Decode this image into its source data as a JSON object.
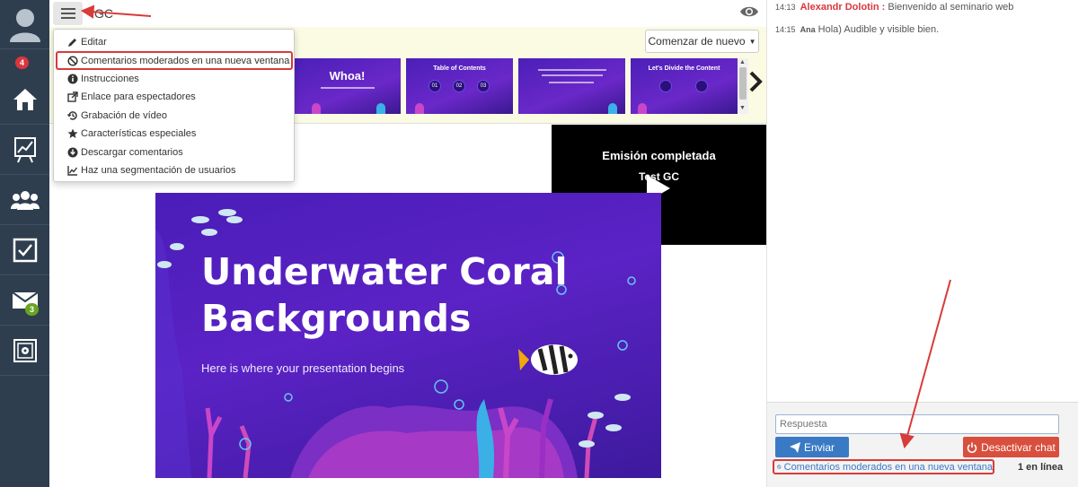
{
  "sidebar": {
    "badges": {
      "profile": "4",
      "mail": "3"
    }
  },
  "topbar": {
    "title": "GC"
  },
  "strip": {
    "start_button": "Comenzar de nuevo",
    "thumbs": [
      {
        "title": "Whoa!"
      },
      {
        "title": "Table of Contents",
        "nums": [
          "01",
          "02",
          "03"
        ]
      },
      {
        "title": ""
      },
      {
        "title": "Let's Divide the Content"
      }
    ]
  },
  "menu": {
    "items": [
      {
        "label": "Editar",
        "icon": "pencil-icon"
      },
      {
        "label": "Comentarios moderados en una nueva ventana",
        "icon": "ban-icon"
      },
      {
        "label": "Instrucciones",
        "icon": "info-icon"
      },
      {
        "label": "Enlace para espectadores",
        "icon": "external-link-icon"
      },
      {
        "label": "Grabación de vídeo",
        "icon": "history-icon"
      },
      {
        "label": "Características especiales",
        "icon": "star-icon"
      },
      {
        "label": "Descargar comentarios",
        "icon": "download-icon"
      },
      {
        "label": "Haz una segmentación de usuarios",
        "icon": "chart-icon"
      }
    ]
  },
  "video": {
    "title": "Emisión completada",
    "subtitle": "Test GC"
  },
  "slide": {
    "title_line1": "Underwater Coral",
    "title_line2": "Backgrounds",
    "subtitle": "Here is where your presentation begins"
  },
  "chat": {
    "messages": [
      {
        "time": "14:13",
        "user": "Alexandr Dolotin :",
        "text": " Bienvenido al seminario web"
      },
      {
        "time": "14:15",
        "user": "Ana",
        "text": " Hola) Audible y visible bien."
      }
    ],
    "reply_placeholder": "Respuesta",
    "send_label": "Enviar",
    "disable_label": "Desactivar chat",
    "moderated_link": "Comentarios moderados en una nueva ventana",
    "online": "1 en línea"
  },
  "colors": {
    "sidebar": "#2f3e4f",
    "accent_blue": "#3a7ac4",
    "danger_red": "#d94f3d",
    "annotation_red": "#d93a3a"
  }
}
